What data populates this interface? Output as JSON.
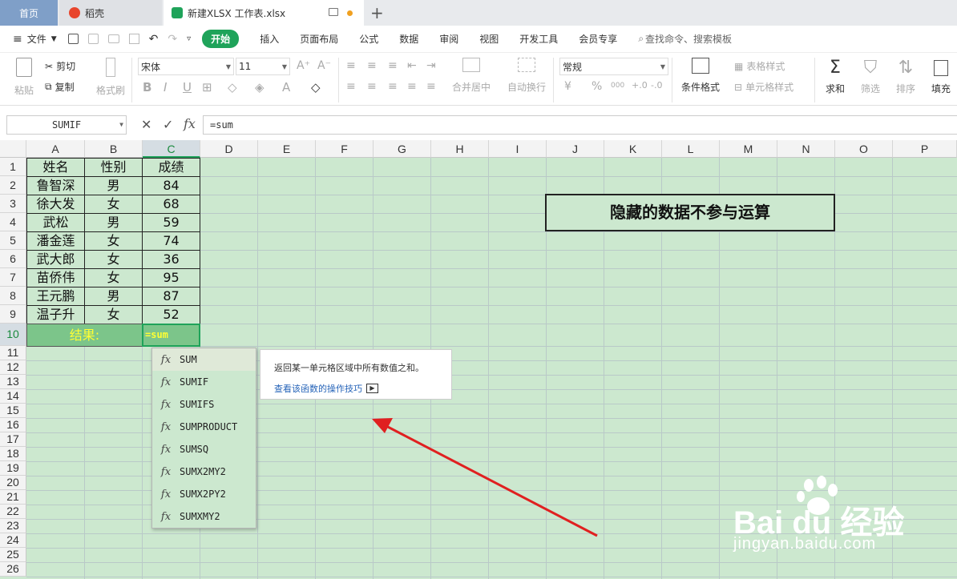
{
  "tabs": {
    "home": "首页",
    "daoke": "稻壳",
    "file": "新建XLSX 工作表.xlsx"
  },
  "menu": {
    "file": "文件",
    "start": "开始",
    "items": [
      "插入",
      "页面布局",
      "公式",
      "数据",
      "审阅",
      "视图",
      "开发工具",
      "会员专享"
    ],
    "search": "查找命令、搜索模板"
  },
  "ribbon": {
    "paste": "粘贴",
    "cut": "剪切",
    "copy": "复制",
    "format_brush": "格式刷",
    "font": "宋体",
    "size": "11",
    "merge": "合并居中",
    "wrap": "自动换行",
    "number_format": "常规",
    "percent": "%",
    "thousand": "000",
    "cond_format": "条件格式",
    "table_style": "表格样式",
    "cell_style": "单元格样式",
    "sum": "求和",
    "filter": "筛选",
    "sort": "排序",
    "fill": "填充"
  },
  "formula_bar": {
    "name_box": "SUMIF",
    "fx": "fx",
    "value": "=sum"
  },
  "columns": [
    "A",
    "B",
    "C",
    "D",
    "E",
    "F",
    "G",
    "H",
    "I",
    "J",
    "K",
    "L",
    "M",
    "N",
    "O",
    "P"
  ],
  "rows": [
    "1",
    "2",
    "3",
    "4",
    "5",
    "6",
    "7",
    "8",
    "9",
    "10",
    "11",
    "12",
    "13",
    "14",
    "15",
    "16",
    "17",
    "18",
    "19",
    "20",
    "21",
    "22",
    "23",
    "24",
    "25",
    "26"
  ],
  "table": {
    "header": [
      "姓名",
      "性别",
      "成绩"
    ],
    "data": [
      [
        "鲁智深",
        "男",
        "84"
      ],
      [
        "徐大发",
        "女",
        "68"
      ],
      [
        "武松",
        "男",
        "59"
      ],
      [
        "潘金莲",
        "女",
        "74"
      ],
      [
        "武大郎",
        "女",
        "36"
      ],
      [
        "苗侨伟",
        "女",
        "95"
      ],
      [
        "王元鹏",
        "男",
        "87"
      ],
      [
        "温子升",
        "女",
        "52"
      ]
    ],
    "result_label": "结果:",
    "result_input": "=sum"
  },
  "autocomplete": {
    "functions": [
      "SUM",
      "SUMIF",
      "SUMIFS",
      "SUMPRODUCT",
      "SUMSQ",
      "SUMX2MY2",
      "SUMX2PY2",
      "SUMXMY2"
    ],
    "selected_index": 0,
    "fx_label": "fx"
  },
  "tooltip": {
    "description": "返回某一单元格区域中所有数值之和。",
    "link": "查看该函数的操作技巧"
  },
  "banner": "隐藏的数据不参与运算",
  "watermark": {
    "brand": "Bai du 经验",
    "url": "jingyan.baidu.com"
  },
  "colors": {
    "sheet_bg": "#cce8cf",
    "result_row": "#7cc58a",
    "result_text": "#ffff33",
    "accent": "#1fa35a",
    "arrow": "#e02020"
  }
}
